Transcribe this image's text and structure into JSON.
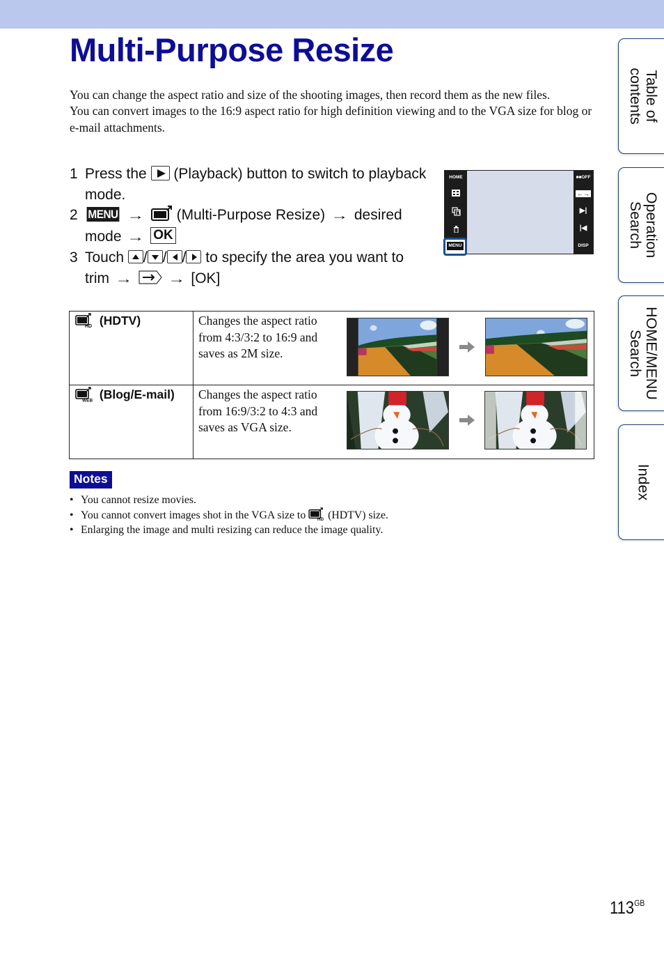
{
  "page": {
    "title": "Multi-Purpose Resize",
    "intro": [
      "You can change the aspect ratio and size of the shooting images, then record them as the new files.",
      "You can convert images to the 16:9 aspect ratio for high definition viewing and to the VGA size for blog or e-mail attachments."
    ],
    "accent_color": "#0d0d96",
    "header_band_color": "#b9c8ec"
  },
  "steps": [
    {
      "num": "1",
      "parts": {
        "a": "Press the",
        "icon": "playback-button-icon",
        "b": "(Playback) button to switch to playback mode."
      }
    },
    {
      "num": "2",
      "parts": {
        "menu": "MENU",
        "icon": "multi-purpose-resize-icon",
        "b": "(Multi-Purpose Resize)",
        "c": "desired mode",
        "ok": "OK"
      }
    },
    {
      "num": "3",
      "parts": {
        "a": "Touch",
        "slash": "/",
        "b": "to specify the area you want to trim",
        "c": "[OK]",
        "icons": [
          "up-arrow-icon",
          "down-arrow-icon",
          "left-arrow-icon",
          "right-arrow-icon",
          "next-arrow-icon"
        ]
      }
    }
  ],
  "camera_screen": {
    "left_buttons": [
      "HOME",
      "index-view-icon",
      "slideshow-icon",
      "delete-icon",
      "MENU"
    ],
    "right_buttons": [
      "OFF",
      "zoom-arrows-icon",
      "next-icon",
      "previous-icon",
      "DISP"
    ]
  },
  "modes": [
    {
      "icon": "hdtv-resize-icon",
      "icon_badge": "HD",
      "label": "(HDTV)",
      "description": "Changes the aspect ratio from 4:3/3:2 to 16:9 and saves as 2M size.",
      "before_image": "flower-field-4x3",
      "after_image": "flower-field-16x9"
    },
    {
      "icon": "blog-email-resize-icon",
      "icon_badge": "WEB",
      "label": "(Blog/E-mail)",
      "description": "Changes the aspect ratio from 16:9/3:2 to 4:3 and saves as VGA size.",
      "before_image": "snowman-16x9",
      "after_image": "snowman-4x3"
    }
  ],
  "notes": {
    "label": "Notes",
    "items": [
      {
        "text": "You cannot resize movies."
      },
      {
        "a": "You cannot convert images shot in the VGA size to",
        "icon": "hdtv-resize-icon",
        "b": "(HDTV) size."
      },
      {
        "text": "Enlarging the image and multi resizing can reduce the image quality."
      }
    ]
  },
  "side_tabs": [
    {
      "line1": "Table of",
      "line2": "contents"
    },
    {
      "line1": "Operation",
      "line2": "Search"
    },
    {
      "line1": "HOME/MENU",
      "line2": "Search"
    },
    {
      "line1": "Index",
      "line2": ""
    }
  ],
  "footer": {
    "page_number": "113",
    "suffix": "GB"
  }
}
